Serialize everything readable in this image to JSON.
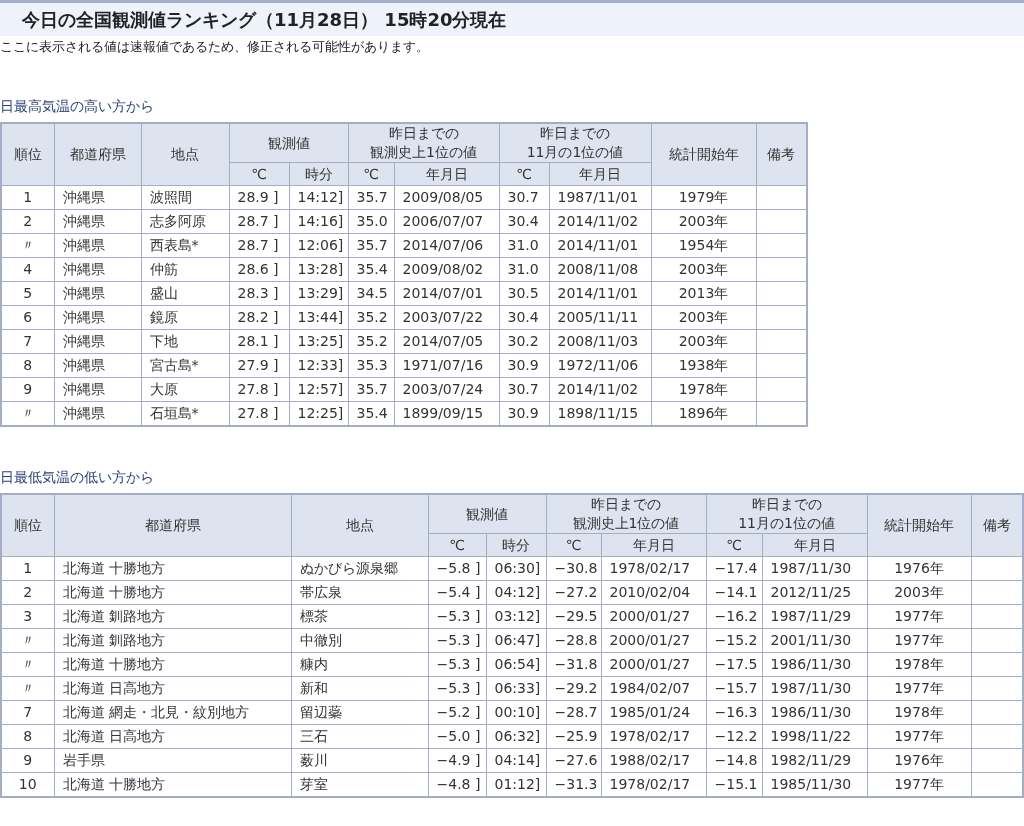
{
  "page": {
    "title": "今日の全国観測値ランキング（11月28日） 15時20分現在",
    "note": "ここに表示される値は速報値であるため、修正される可能性があります。"
  },
  "tables": [
    {
      "heading": "日最高気温の高い方から",
      "header_rows": [
        [
          {
            "text": "順位",
            "rowspan": 2
          },
          {
            "text": "都道府県",
            "rowspan": 2
          },
          {
            "text": "地点",
            "rowspan": 2
          },
          {
            "text": "観測値",
            "colspan": 2
          },
          {
            "lines": [
              "昨日までの",
              "観測史上1位の値"
            ],
            "colspan": 2
          },
          {
            "lines": [
              "昨日までの",
              "11月の1位の値"
            ],
            "colspan": 2
          },
          {
            "text": "統計開始年",
            "rowspan": 2
          },
          {
            "text": "備考",
            "rowspan": 2
          }
        ],
        [
          {
            "text": "℃"
          },
          {
            "text": "時分"
          },
          {
            "text": "℃"
          },
          {
            "text": "年月日"
          },
          {
            "text": "℃"
          },
          {
            "text": "年月日"
          }
        ]
      ],
      "rows": [
        [
          "1",
          "沖縄県",
          "波照間",
          "28.9 ]",
          "14:12]",
          "35.7",
          "2009/08/05",
          "30.7",
          "1987/11/01",
          "1979年"
        ],
        [
          "2",
          "沖縄県",
          "志多阿原",
          "28.7 ]",
          "14:16]",
          "35.0",
          "2006/07/07",
          "30.4",
          "2014/11/02",
          "2003年"
        ],
        [
          "〃",
          "沖縄県",
          "西表島*",
          "28.7 ]",
          "12:06]",
          "35.7",
          "2014/07/06",
          "31.0",
          "2014/11/01",
          "1954年"
        ],
        [
          "4",
          "沖縄県",
          "仲筋",
          "28.6 ]",
          "13:28]",
          "35.4",
          "2009/08/02",
          "31.0",
          "2008/11/08",
          "2003年"
        ],
        [
          "5",
          "沖縄県",
          "盛山",
          "28.3 ]",
          "13:29]",
          "34.5",
          "2014/07/01",
          "30.5",
          "2014/11/01",
          "2013年"
        ],
        [
          "6",
          "沖縄県",
          "鏡原",
          "28.2 ]",
          "13:44]",
          "35.2",
          "2003/07/22",
          "30.4",
          "2005/11/11",
          "2003年"
        ],
        [
          "7",
          "沖縄県",
          "下地",
          "28.1 ]",
          "13:25]",
          "35.2",
          "2014/07/05",
          "30.2",
          "2008/11/03",
          "2003年"
        ],
        [
          "8",
          "沖縄県",
          "宮古島*",
          "27.9 ]",
          "12:33]",
          "35.3",
          "1971/07/16",
          "30.9",
          "1972/11/06",
          "1938年"
        ],
        [
          "9",
          "沖縄県",
          "大原",
          "27.8 ]",
          "12:57]",
          "35.7",
          "2003/07/24",
          "30.7",
          "2014/11/02",
          "1978年"
        ],
        [
          "〃",
          "沖縄県",
          "石垣島*",
          "27.8 ]",
          "12:25]",
          "35.4",
          "1899/09/15",
          "30.9",
          "1898/11/15",
          "1896年"
        ]
      ]
    },
    {
      "heading": "日最低気温の低い方から",
      "header_rows": [
        [
          {
            "text": "順位",
            "rowspan": 2
          },
          {
            "text": "都道府県",
            "rowspan": 2
          },
          {
            "text": "地点",
            "rowspan": 2
          },
          {
            "text": "観測値",
            "colspan": 2
          },
          {
            "lines": [
              "昨日までの",
              "観測史上1位の値"
            ],
            "colspan": 2
          },
          {
            "lines": [
              "昨日までの",
              "11月の1位の値"
            ],
            "colspan": 2
          },
          {
            "text": "統計開始年",
            "rowspan": 2
          },
          {
            "text": "備考",
            "rowspan": 2
          }
        ],
        [
          {
            "text": "℃"
          },
          {
            "text": "時分"
          },
          {
            "text": "℃"
          },
          {
            "text": "年月日"
          },
          {
            "text": "℃"
          },
          {
            "text": "年月日"
          }
        ]
      ],
      "rows": [
        [
          "1",
          "北海道 十勝地方",
          "ぬかびら源泉郷",
          "−5.8 ]",
          "06:30]",
          "−30.8",
          "1978/02/17",
          "−17.4",
          "1987/11/30",
          "1976年"
        ],
        [
          "2",
          "北海道 十勝地方",
          "帯広泉",
          "−5.4 ]",
          "04:12]",
          "−27.2",
          "2010/02/04",
          "−14.1",
          "2012/11/25",
          "2003年"
        ],
        [
          "3",
          "北海道 釧路地方",
          "標茶",
          "−5.3 ]",
          "03:12]",
          "−29.5",
          "2000/01/27",
          "−16.2",
          "1987/11/29",
          "1977年"
        ],
        [
          "〃",
          "北海道 釧路地方",
          "中徹別",
          "−5.3 ]",
          "06:47]",
          "−28.8",
          "2000/01/27",
          "−15.2",
          "2001/11/30",
          "1977年"
        ],
        [
          "〃",
          "北海道 十勝地方",
          "糠内",
          "−5.3 ]",
          "06:54]",
          "−31.8",
          "2000/01/27",
          "−17.5",
          "1986/11/30",
          "1978年"
        ],
        [
          "〃",
          "北海道 日高地方",
          "新和",
          "−5.3 ]",
          "06:33]",
          "−29.2",
          "1984/02/07",
          "−15.7",
          "1987/11/30",
          "1977年"
        ],
        [
          "7",
          "北海道 網走・北見・紋別地方",
          "留辺蘂",
          "−5.2 ]",
          "00:10]",
          "−28.7",
          "1985/01/24",
          "−16.3",
          "1986/11/30",
          "1978年"
        ],
        [
          "8",
          "北海道 日高地方",
          "三石",
          "−5.0 ]",
          "06:32]",
          "−25.9",
          "1978/02/17",
          "−12.2",
          "1998/11/22",
          "1977年"
        ],
        [
          "9",
          "岩手県",
          "薮川",
          "−4.9 ]",
          "04:14]",
          "−27.6",
          "1988/02/17",
          "−14.8",
          "1982/11/29",
          "1976年"
        ],
        [
          "10",
          "北海道 十勝地方",
          "芽室",
          "−4.8 ]",
          "01:12]",
          "−31.3",
          "1978/02/17",
          "−15.1",
          "1985/11/30",
          "1977年"
        ]
      ]
    }
  ]
}
